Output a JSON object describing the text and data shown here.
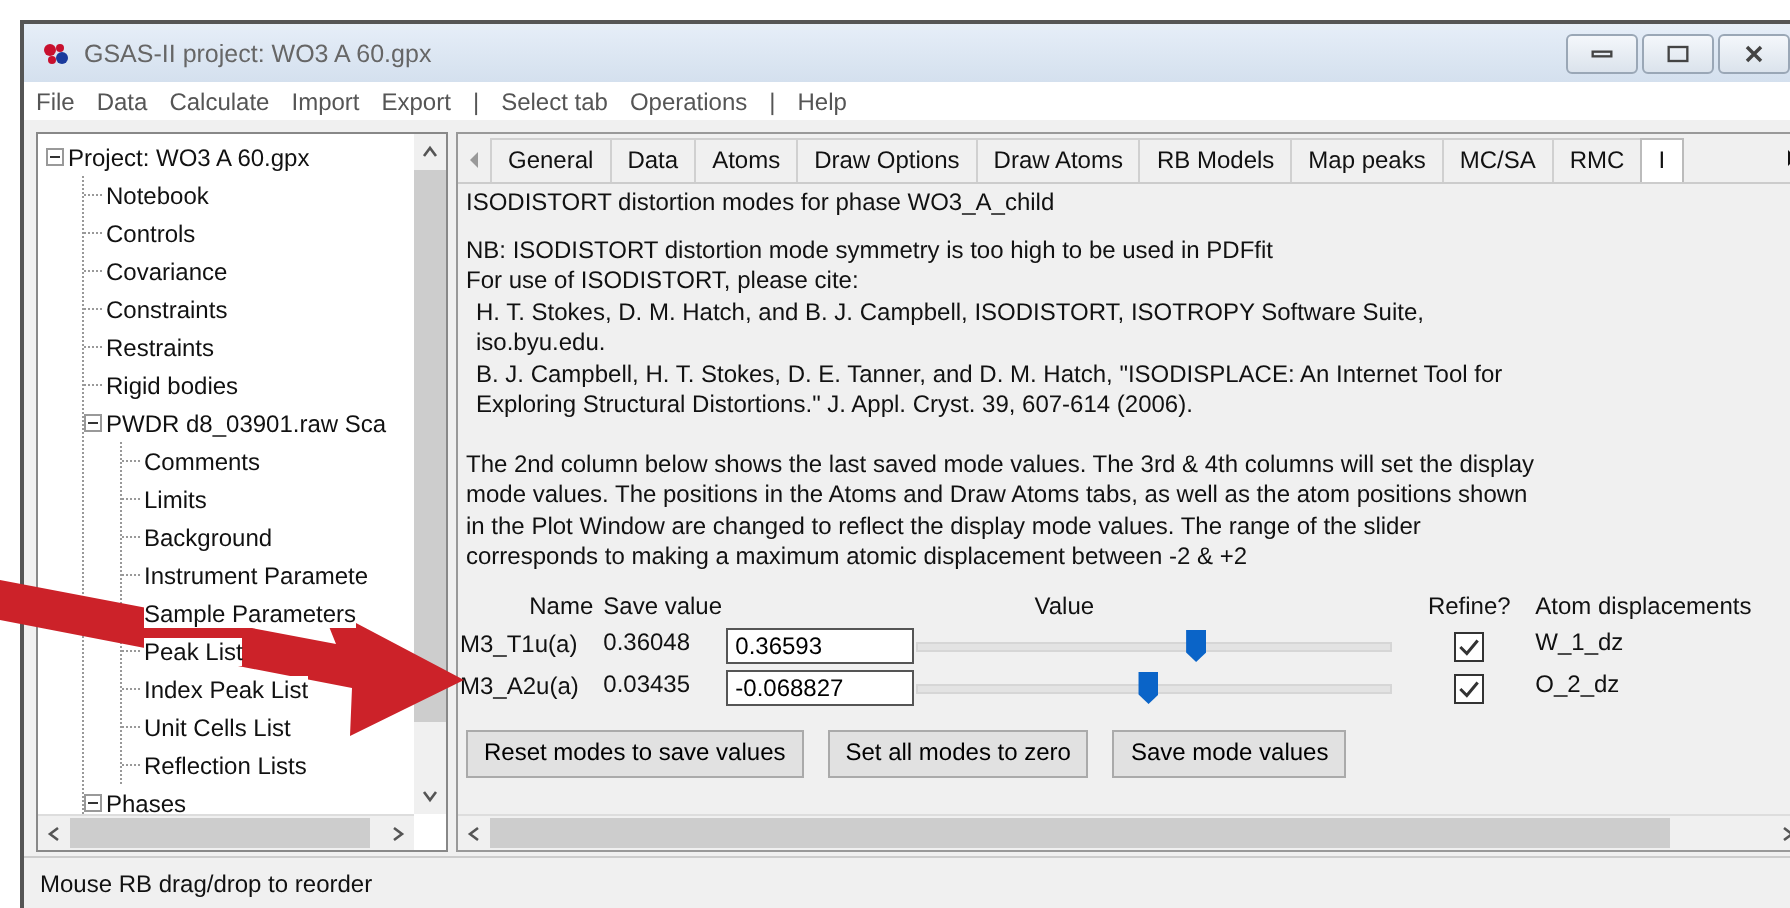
{
  "window": {
    "title": "GSAS-II project: WO3 A 60.gpx"
  },
  "menu": [
    "File",
    "Data",
    "Calculate",
    "Import",
    "Export",
    "|",
    "Select tab",
    "Operations",
    "|",
    "Help"
  ],
  "tree": [
    {
      "label": "Project: WO3 A 60.gpx",
      "expanded": true,
      "children": [
        {
          "label": "Notebook"
        },
        {
          "label": "Controls"
        },
        {
          "label": "Covariance"
        },
        {
          "label": "Constraints"
        },
        {
          "label": "Restraints"
        },
        {
          "label": "Rigid bodies"
        },
        {
          "label": "PWDR d8_03901.raw Sca",
          "expanded": true,
          "children": [
            {
              "label": "Comments"
            },
            {
              "label": "Limits"
            },
            {
              "label": "Background"
            },
            {
              "label": "Instrument Paramete"
            },
            {
              "label": "Sample Parameters"
            },
            {
              "label": "Peak List"
            },
            {
              "label": "Index Peak List"
            },
            {
              "label": "Unit Cells List"
            },
            {
              "label": "Reflection Lists"
            }
          ]
        },
        {
          "label": "Phases",
          "expanded": true
        }
      ]
    }
  ],
  "tabs": [
    {
      "label": "General",
      "selected": false
    },
    {
      "label": "Data",
      "selected": false
    },
    {
      "label": "Atoms",
      "selected": false
    },
    {
      "label": "Draw Options",
      "selected": false
    },
    {
      "label": "Draw Atoms",
      "selected": false
    },
    {
      "label": "RB Models",
      "selected": false
    },
    {
      "label": "Map peaks",
      "selected": false
    },
    {
      "label": "MC/SA",
      "selected": false
    },
    {
      "label": "RMC",
      "selected": false
    },
    {
      "label": "I",
      "selected": true
    }
  ],
  "heading": "ISODISTORT distortion modes for phase WO3_A_child",
  "notes": [
    "NB: ISODISTORT distortion mode symmetry is too high to be used in PDFfit",
    "For use of ISODISTORT, please cite:"
  ],
  "citations": [
    "H. T. Stokes, D. M. Hatch, and B. J. Campbell, ISODISTORT, ISOTROPY Software Suite, iso.byu.edu.",
    "B. J. Campbell, H. T. Stokes, D. E. Tanner, and D. M. Hatch, \"ISODISPLACE: An Internet Tool for Exploring Structural Distortions.\" J. Appl. Cryst. 39, 607-614 (2006)."
  ],
  "explanation": "The 2nd column below shows the last saved mode values. The 3rd & 4th columns will set the display mode values. The positions in the Atoms and Draw Atoms tabs, as well as the atom positions shown in the Plot Window are changed to reflect the display mode values. The range of the slider corresponds to making a maximum atomic displacement between -2 & +2",
  "columns": [
    "Name",
    "Save value",
    "Value",
    "Refine?",
    "Atom displacements"
  ],
  "modes": [
    {
      "name": "M3_T1u(a)",
      "save_value": "0.36048",
      "value": "0.36593",
      "level": 0.59,
      "refine": true,
      "atom": "W_1_dz"
    },
    {
      "name": "M3_A2u(a)",
      "save_value": "0.03435",
      "value": "-0.068827",
      "level": 0.49,
      "refine": true,
      "atom": "O_2_dz"
    }
  ],
  "buttons": [
    "Reset modes to save values",
    "Set all modes to zero",
    "Save mode values"
  ],
  "status_bar": "Mouse RB drag/drop to reorder"
}
